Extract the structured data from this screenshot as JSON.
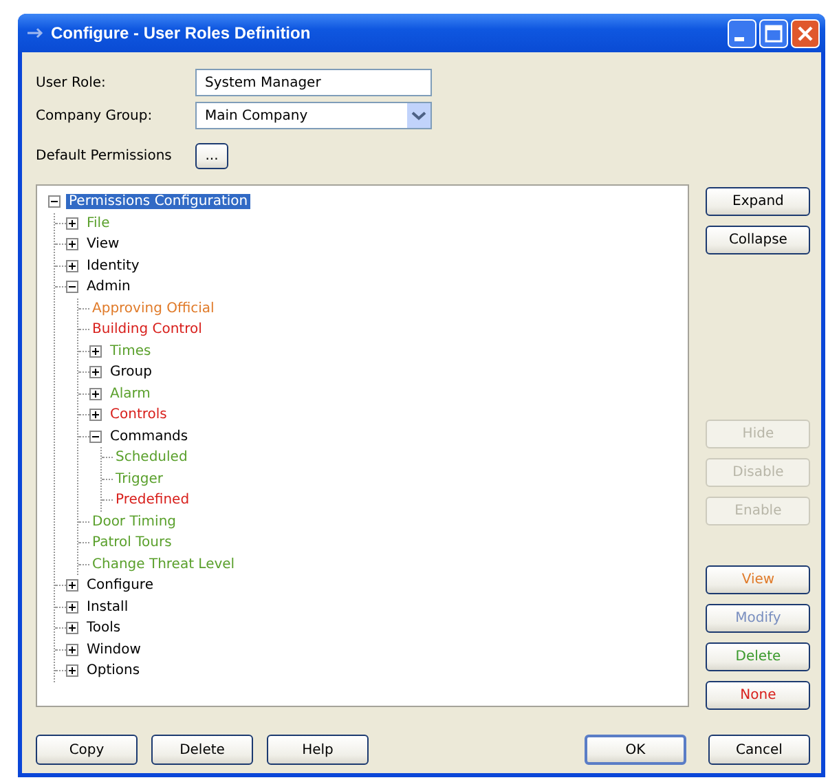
{
  "window": {
    "title": "Configure - User Roles Definition"
  },
  "form": {
    "user_role": {
      "label": "User Role:",
      "value": "System Manager"
    },
    "company_group": {
      "label": "Company Group:",
      "value": "Main Company"
    },
    "default_permissions": {
      "label": "Default Permissions",
      "button": "..."
    }
  },
  "tree": {
    "label": "Permissions Configuration",
    "selected": true,
    "expanded": true,
    "children": [
      {
        "label": "File",
        "color": "#5aa02c",
        "selected": false,
        "expanded": false
      },
      {
        "label": "View",
        "color": "#000000",
        "selected": false,
        "expanded": false
      },
      {
        "label": "Identity",
        "color": "#000000",
        "selected": false,
        "expanded": false
      },
      {
        "label": "Admin",
        "color": "#000000",
        "selected": false,
        "expanded": true,
        "children": [
          {
            "label": "Approving Official",
            "color": "#e07b2a",
            "selected": false
          },
          {
            "label": "Building Control",
            "color": "#d8201c",
            "selected": false
          },
          {
            "label": "Times",
            "color": "#5aa02c",
            "selected": false,
            "expanded": false
          },
          {
            "label": "Group",
            "color": "#000000",
            "selected": false,
            "expanded": false
          },
          {
            "label": "Alarm",
            "color": "#5aa02c",
            "selected": false,
            "expanded": false
          },
          {
            "label": "Controls",
            "color": "#d8201c",
            "selected": false,
            "expanded": false
          },
          {
            "label": "Commands",
            "color": "#000000",
            "selected": false,
            "expanded": true,
            "children": [
              {
                "label": "Scheduled",
                "color": "#5aa02c",
                "selected": false
              },
              {
                "label": "Trigger",
                "color": "#5aa02c",
                "selected": false
              },
              {
                "label": "Predefined",
                "color": "#d8201c",
                "selected": false
              }
            ]
          },
          {
            "label": "Door Timing",
            "color": "#5aa02c",
            "selected": false
          },
          {
            "label": "Patrol Tours",
            "color": "#5aa02c",
            "selected": false
          },
          {
            "label": "Change Threat Level",
            "color": "#5aa02c",
            "selected": false
          }
        ]
      },
      {
        "label": "Configure",
        "color": "#000000",
        "selected": false,
        "expanded": false
      },
      {
        "label": "Install",
        "color": "#000000",
        "selected": false,
        "expanded": false
      },
      {
        "label": "Tools",
        "color": "#000000",
        "selected": false,
        "expanded": false
      },
      {
        "label": "Window",
        "color": "#000000",
        "selected": false,
        "expanded": false
      },
      {
        "label": "Options",
        "color": "#000000",
        "selected": false,
        "expanded": false
      }
    ]
  },
  "side_buttons": [
    {
      "label": "Expand",
      "disabled": false
    },
    {
      "label": "Collapse",
      "disabled": false
    },
    {
      "label": "Hide",
      "disabled": true
    },
    {
      "label": "Disable",
      "disabled": true
    },
    {
      "label": "Enable",
      "disabled": true
    },
    {
      "label": "View",
      "disabled": false,
      "color": "#e07b2a"
    },
    {
      "label": "Modify",
      "disabled": false,
      "color": "#7a8fc0"
    },
    {
      "label": "Delete",
      "disabled": false,
      "color": "#3a9a2c"
    },
    {
      "label": "None",
      "disabled": false,
      "color": "#d8201c"
    }
  ],
  "footer_buttons": [
    {
      "label": "Copy",
      "default": false
    },
    {
      "label": "Delete",
      "default": false
    },
    {
      "label": "Help",
      "default": false
    },
    {
      "label": "OK",
      "default": true
    },
    {
      "label": "Cancel",
      "default": false
    }
  ]
}
